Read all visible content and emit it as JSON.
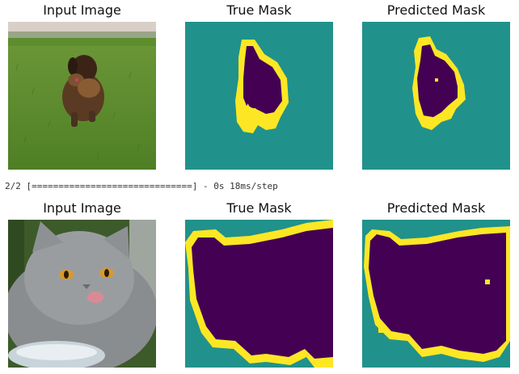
{
  "row1": {
    "titles": [
      "Input Image",
      "True Mask",
      "Predicted Mask"
    ]
  },
  "progress_log": "2/2 [==============================] - 0s 18ms/step",
  "row2": {
    "titles": [
      "Input Image",
      "True Mask",
      "Predicted Mask"
    ]
  },
  "colors": {
    "mask_background": "#21918c",
    "mask_object": "#440154",
    "mask_border": "#fde725"
  }
}
